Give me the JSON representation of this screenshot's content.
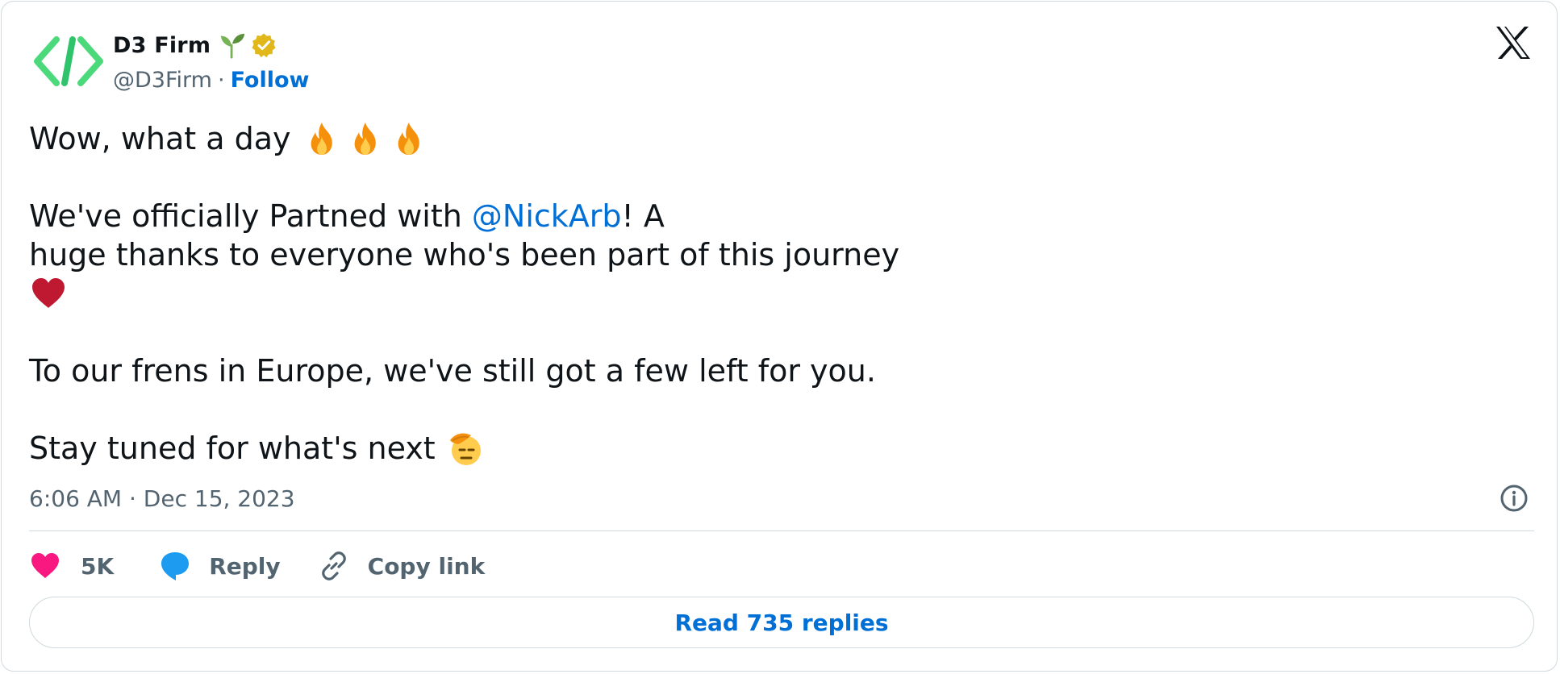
{
  "author": {
    "display_name": "D3 Firm",
    "handle": "@D3Firm",
    "separator": "·",
    "follow_label": "Follow",
    "name_emoji": "sprout-icon",
    "badge": "verified-gold-icon"
  },
  "platform_logo": "x-logo-icon",
  "tweet": {
    "line1": "Wow, what a day",
    "line1_emojis": [
      "fire-emoji",
      "fire-emoji",
      "fire-emoji"
    ],
    "line2_before": "We've officially Partned with ",
    "line2_mention": "@NickArb",
    "line2_after": "! A",
    "line3": "huge thanks to everyone who's been part of this journey",
    "line4_emoji": "red-heart-emoji",
    "line5": "To our frens in Europe, we've still got a few left for you.",
    "line6": "Stay tuned for what's next",
    "line6_emoji": "saluting-face-emoji"
  },
  "meta": {
    "timestamp": "6:06 AM · Dec 15, 2023",
    "info_icon": "info-icon"
  },
  "actions": {
    "like_count": "5K",
    "reply_label": "Reply",
    "copy_label": "Copy link"
  },
  "read_replies_label": "Read 735 replies",
  "colors": {
    "link": "#006fd6",
    "muted": "#536471",
    "text": "#0f1419",
    "border": "#cfd9de",
    "like": "#f91880",
    "reply": "#1d9bf0",
    "verified": "#e2b719",
    "logo_green": "#4cd97b"
  }
}
